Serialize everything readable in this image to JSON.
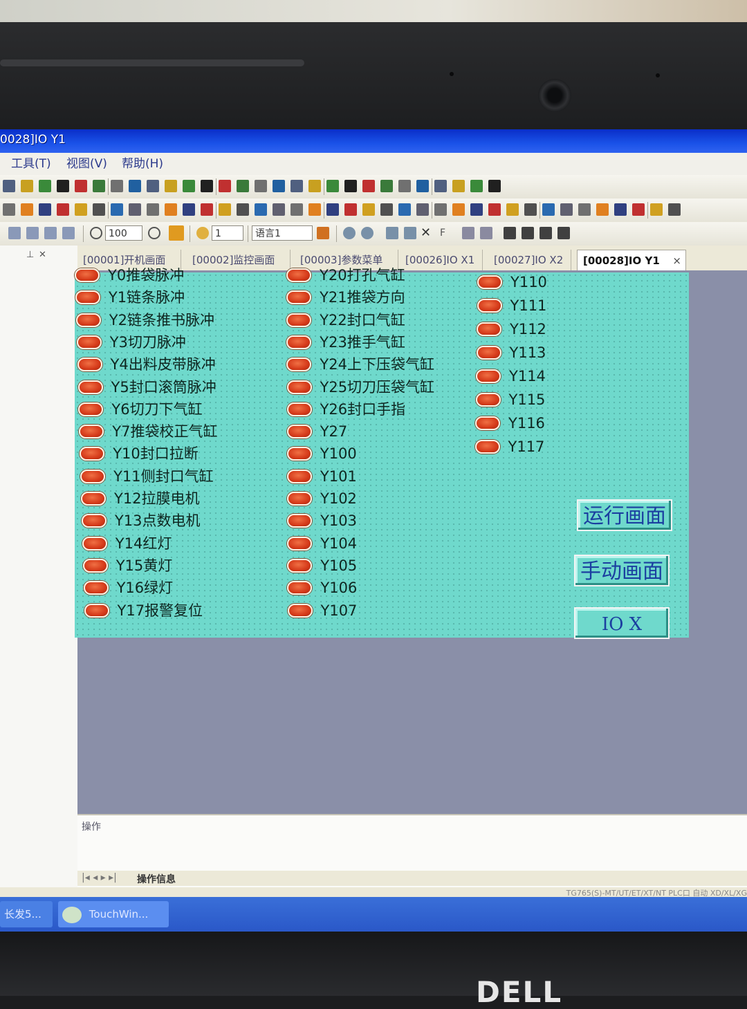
{
  "window": {
    "title": "0028]IO Y1"
  },
  "menu": [
    "工具(T)",
    "视图(V)",
    "帮助(H)"
  ],
  "toolbar": {
    "zoom": "100",
    "count": "1",
    "language": "语言1"
  },
  "tabs": [
    {
      "label": "[00001]开机画面",
      "active": false
    },
    {
      "label": "[00002]监控画面",
      "active": false
    },
    {
      "label": "[00003]参数菜单",
      "active": false
    },
    {
      "label": "[00026]IO X1",
      "active": false
    },
    {
      "label": "[00027]IO X2",
      "active": false
    },
    {
      "label": "[00028]IO Y1",
      "active": true
    }
  ],
  "tab_close": "×",
  "io_columns": [
    [
      "Y0推袋脉冲",
      "Y1链条脉冲",
      "Y2链条推书脉冲",
      "Y3切刀脉冲",
      "Y4出料皮带脉冲",
      "Y5封口滚筒脉冲",
      "Y6切刀下气缸",
      "Y7推袋校正气缸",
      "Y10封口拉断",
      "Y11侧封口气缸",
      "Y12拉膜电机",
      "Y13点数电机",
      "Y14红灯",
      "Y15黄灯",
      "Y16绿灯",
      "Y17报警复位"
    ],
    [
      "Y20打孔气缸",
      "Y21推袋方向",
      "Y22封口气缸",
      "Y23推手气缸",
      "Y24上下压袋气缸",
      "Y25切刀压袋气缸",
      "Y26封口手指",
      "Y27",
      "Y100",
      "Y101",
      "Y102",
      "Y103",
      "Y104",
      "Y105",
      "Y106",
      "Y107"
    ],
    [
      "Y110",
      "Y111",
      "Y112",
      "Y113",
      "Y114",
      "Y115",
      "Y116",
      "Y117"
    ]
  ],
  "buttons": {
    "run": "运行画面",
    "manual": "手动画面",
    "io_x": "IO X"
  },
  "output": {
    "title": "操作",
    "tab": "操作信息"
  },
  "status_text": "TG765(S)-MT/UT/ET/XT/NT   PLC口   自动 XD/XL/XG",
  "taskbar": {
    "item1": "长发5...",
    "item2": "TouchWin..."
  },
  "brand": "DELL"
}
